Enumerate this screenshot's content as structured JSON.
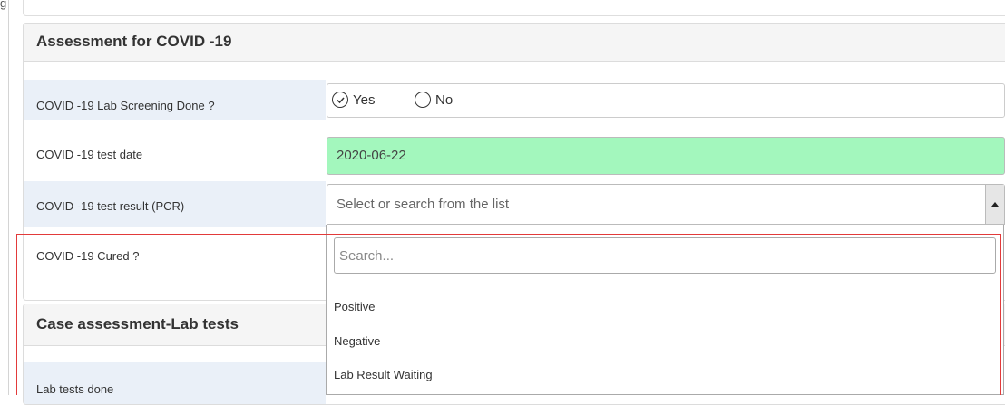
{
  "corner_text": "g",
  "covid_panel": {
    "title": "Assessment for COVID -19",
    "screening": {
      "label": "COVID -19 Lab Screening Done ?",
      "options": [
        {
          "label": "Yes",
          "checked": true
        },
        {
          "label": "No",
          "checked": false
        }
      ]
    },
    "test_date": {
      "label": "COVID -19 test date",
      "value": "2020-06-22",
      "background": "#a3f7bd"
    },
    "test_result": {
      "label": "COVID -19 test result (PCR)",
      "placeholder": "Select or search from the list",
      "dropdown": {
        "search_placeholder": "Search...",
        "options": [
          "Positive",
          "Negative",
          "Lab Result Waiting"
        ]
      }
    },
    "cured": {
      "label": "COVID -19 Cured ?"
    }
  },
  "lab_panel": {
    "title": "Case assessment-Lab tests",
    "lab_tests_label": "Lab tests done"
  },
  "colors": {
    "label_bg": "#eaf0f8",
    "highlight": "#e23a3a"
  }
}
